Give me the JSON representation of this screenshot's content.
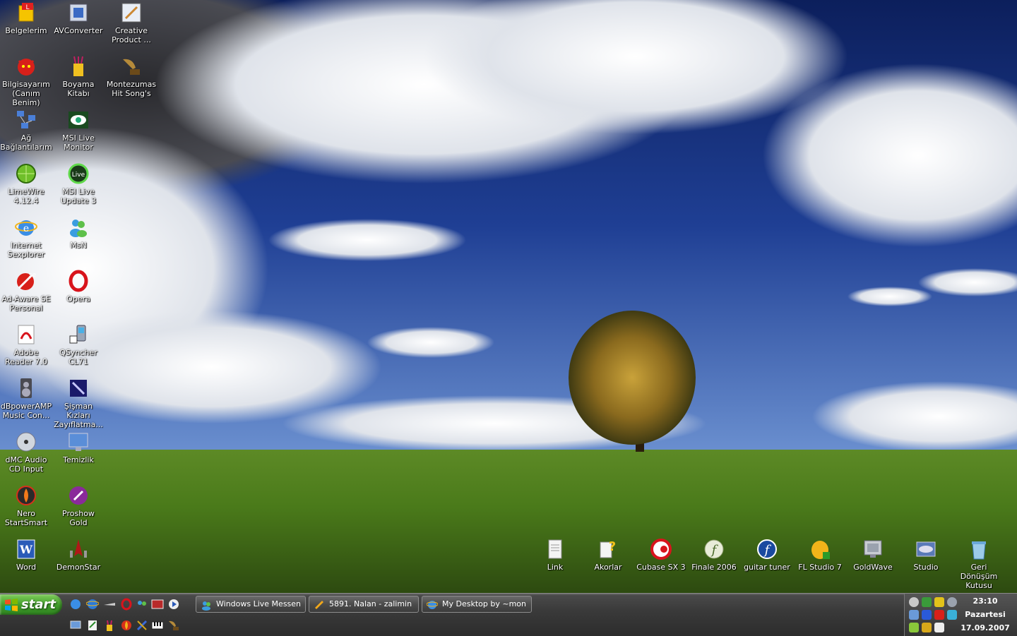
{
  "desktop_icons": {
    "belgelerim": "Belgelerim",
    "avconverter": "AVConverter",
    "creative": "Creative Product ...",
    "bilgisayarim": "Bilgisayarım (Canım Benim)",
    "boyama": "Boyama Kitabı",
    "montezumas": "Montezumas Hit Song's",
    "ag": "Ağ Bağlantılarım",
    "msi_monitor": "MSI Live Monitor",
    "limewire": "LimeWire 4.12.4",
    "msi_update": "MSI Live Update 3",
    "ie": "Internet Sexplorer",
    "msn": "MsN",
    "adaware": "Ad-Aware SE Personal",
    "opera": "Opera",
    "adobe": "Adobe Reader 7.0",
    "qsyncher": "QSyncher CL71",
    "dbpoweramp": "dBpowerAMP Music Con...",
    "sisman": "Şişman Kızları Zayıflatma...",
    "dmc": "dMC Audio CD Input",
    "temizlik": "Temizlik",
    "nero": "Nero StartSmart",
    "proshow": "Proshow Gold",
    "word": "Word",
    "demonstar": "DemonStar",
    "link": "Link",
    "akorlar": "Akorlar",
    "cubase": "Cubase SX 3",
    "finale": "Finale 2006",
    "guitar": "guitar tuner",
    "flstudio": "FL Studio 7",
    "goldwave": "GoldWave",
    "studio": "Studio",
    "recycle": "Geri Dönüşüm Kutusu"
  },
  "taskbar": {
    "start_label": "start",
    "tasks": [
      {
        "label": "Windows Live Messen..."
      },
      {
        "label": "5891. Nalan - zalimin ..."
      },
      {
        "label": "My Desktop by ~mon..."
      }
    ],
    "clock": {
      "time": "23:10",
      "day": "Pazartesi",
      "date": "17.09.2007"
    }
  },
  "colors": {
    "sky": "#1e3a8f",
    "grass": "#4f7a1c",
    "start_green": "#3f9a2a",
    "taskbar": "#3a3a3a"
  }
}
